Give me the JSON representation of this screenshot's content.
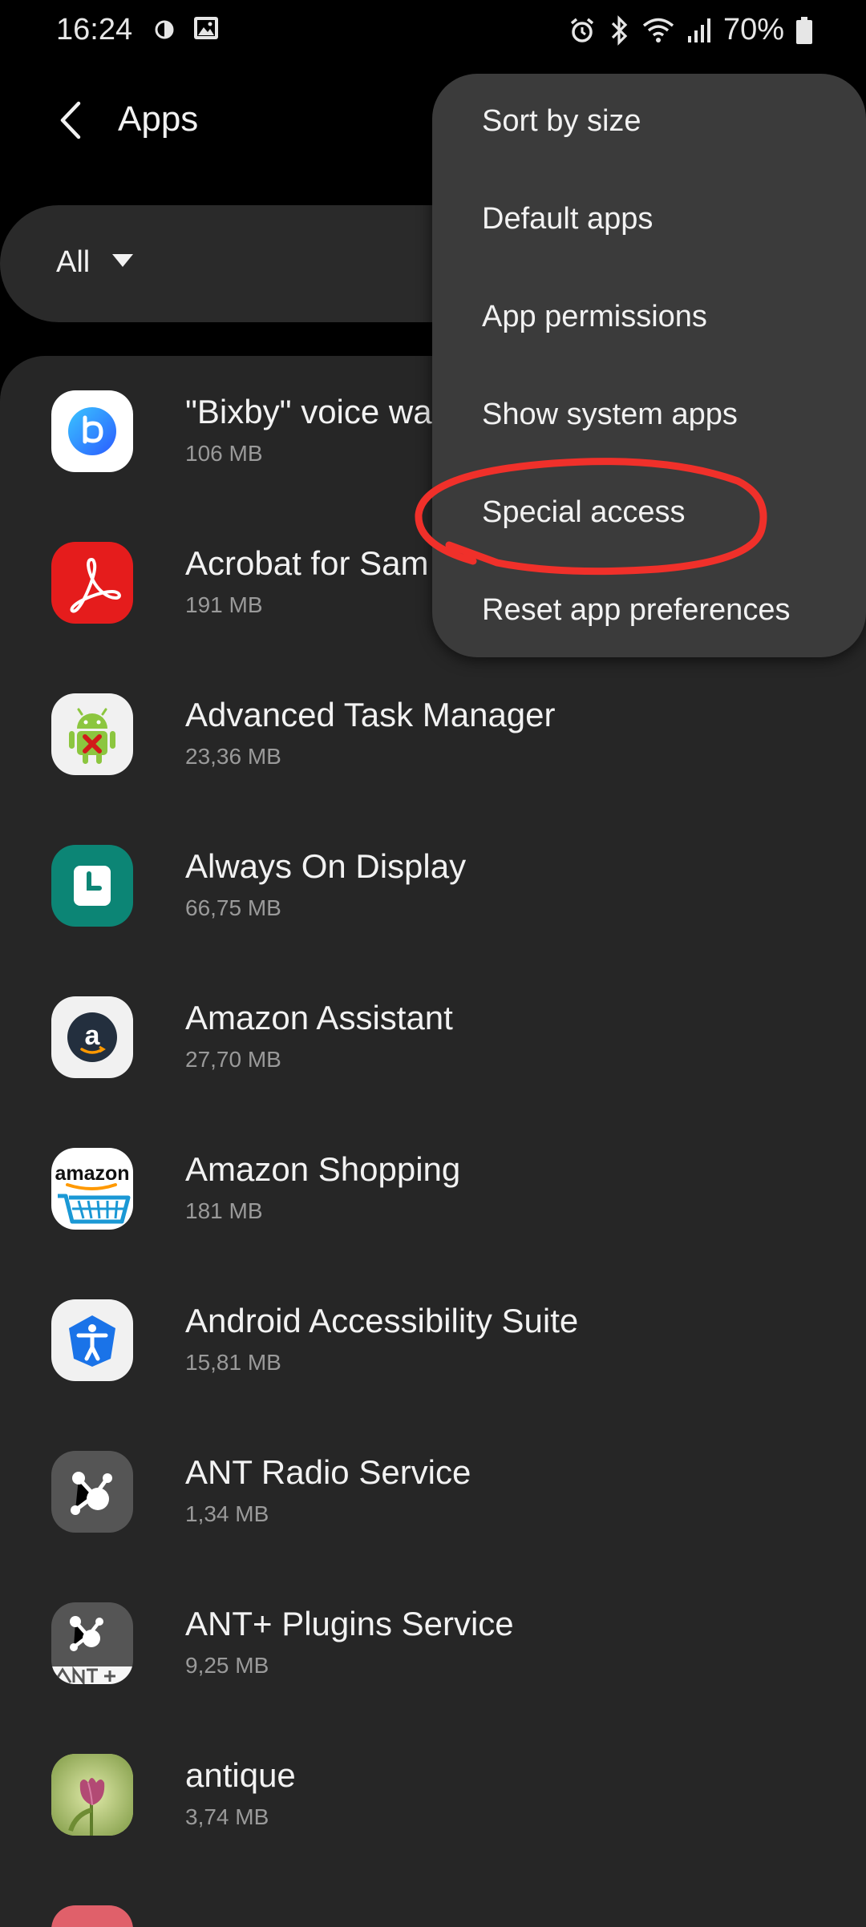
{
  "status_bar": {
    "time": "16:24",
    "battery": "70%",
    "icons": [
      "brightness-icon",
      "image-icon",
      "alarm-icon",
      "bluetooth-icon",
      "wifi-icon",
      "signal-icon",
      "battery-icon"
    ]
  },
  "header": {
    "title": "Apps",
    "back_icon": "back-arrow-icon"
  },
  "filter": {
    "selected": "All",
    "icon": "dropdown-triangle-icon"
  },
  "apps": [
    {
      "name": "\"Bixby\" voice wa",
      "size": "106 MB",
      "icon": "bixby-icon"
    },
    {
      "name": "Acrobat for Sam",
      "size": "191 MB",
      "icon": "acrobat-icon"
    },
    {
      "name": "Advanced Task Manager",
      "size": "23,36 MB",
      "icon": "android-robot-icon"
    },
    {
      "name": "Always On Display",
      "size": "66,75 MB",
      "icon": "clock-icon"
    },
    {
      "name": "Amazon Assistant",
      "size": "27,70 MB",
      "icon": "amazon-assistant-icon"
    },
    {
      "name": "Amazon Shopping",
      "size": "181 MB",
      "icon": "amazon-shopping-icon"
    },
    {
      "name": "Android Accessibility Suite",
      "size": "15,81 MB",
      "icon": "accessibility-icon"
    },
    {
      "name": "ANT Radio Service",
      "size": "1,34 MB",
      "icon": "ant-radio-icon"
    },
    {
      "name": "ANT+ Plugins Service",
      "size": "9,25 MB",
      "icon": "ant-plugins-icon"
    },
    {
      "name": "antique",
      "size": "3,74 MB",
      "icon": "tulip-icon"
    }
  ],
  "menu": {
    "items": [
      {
        "label": "Sort by size"
      },
      {
        "label": "Default apps"
      },
      {
        "label": "App permissions"
      },
      {
        "label": "Show system apps"
      },
      {
        "label": "Special access"
      },
      {
        "label": "Reset app preferences"
      }
    ],
    "highlighted_item": "Special access",
    "annotation_color": "#f0302a"
  },
  "colors": {
    "background": "#000000",
    "card": "#262626",
    "filter_bar": "#2a2a2a",
    "menu": "#3b3b3b",
    "primary_text": "#f2f2f2",
    "secondary_text": "#9a9a9a"
  }
}
